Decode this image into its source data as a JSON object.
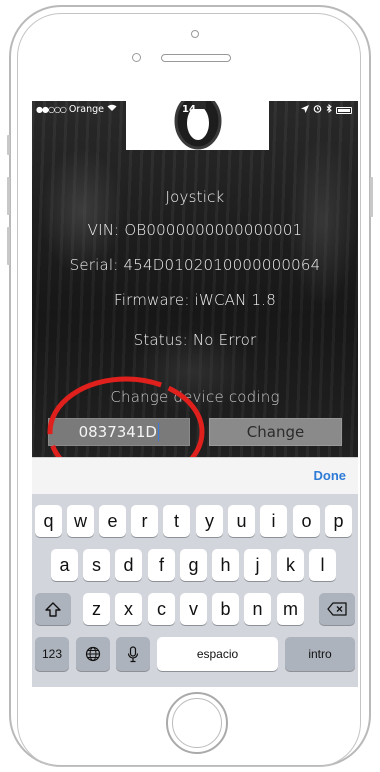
{
  "status_bar": {
    "carrier": "Orange",
    "signal_dots": "●●○○○",
    "time": "14"
  },
  "device": {
    "name": "Joystick",
    "vin": "VIN: OB0000000000000001",
    "serial": "Serial:  454D0102010000000064",
    "firmware": "Firmware:  iWCAN 1.8",
    "status": "Status:  No Error"
  },
  "coding": {
    "title": "Change device coding",
    "input_value": "0837341D",
    "change_label": "Change"
  },
  "keyboard": {
    "done_label": "Done",
    "row1": [
      "q",
      "w",
      "e",
      "r",
      "t",
      "y",
      "u",
      "i",
      "o",
      "p"
    ],
    "row2": [
      "a",
      "s",
      "d",
      "f",
      "g",
      "h",
      "j",
      "k",
      "l"
    ],
    "row3": [
      "z",
      "x",
      "c",
      "v",
      "b",
      "n",
      "m"
    ],
    "numbers_label": "123",
    "space_label": "espacio",
    "return_label": "intro"
  },
  "colors": {
    "annotation_red": "#e0201c",
    "done_blue": "#2e7bd6"
  }
}
